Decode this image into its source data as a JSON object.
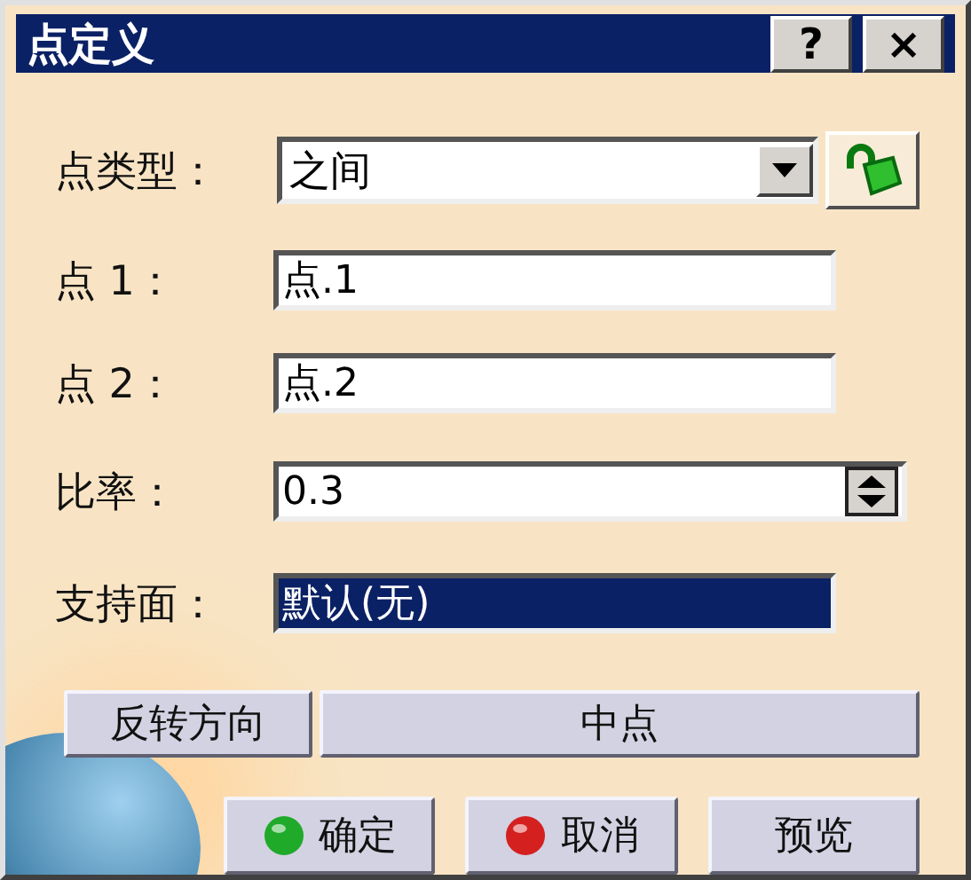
{
  "window": {
    "title": "点定义",
    "help": "?",
    "close": "×"
  },
  "point_type": {
    "label": "点类型：",
    "value": "之间"
  },
  "fields": [
    {
      "kind": "text",
      "label": "点 1：",
      "value": "点.1",
      "selected": false
    },
    {
      "kind": "text",
      "label": "点 2：",
      "value": "点.2",
      "selected": false
    },
    {
      "kind": "spin",
      "label": "比率：",
      "value": "0.3",
      "selected": false
    },
    {
      "kind": "text",
      "label": "支持面：",
      "value": "默认(无)",
      "selected": true
    }
  ],
  "actions": [
    "反转方向",
    "中点"
  ],
  "buttons": [
    {
      "kind": "ok",
      "label": "确定"
    },
    {
      "kind": "cancel",
      "label": "取消"
    },
    {
      "kind": "plain",
      "label": "预览"
    }
  ]
}
